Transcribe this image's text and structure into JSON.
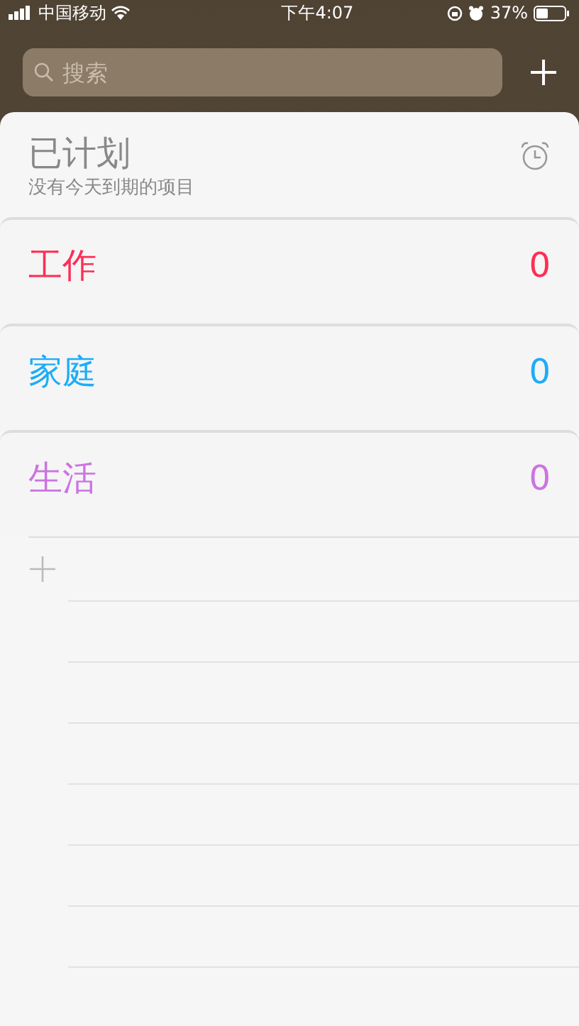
{
  "status_bar": {
    "carrier": "中国移动",
    "time": "下午4:07",
    "battery": "37%"
  },
  "search": {
    "placeholder": "搜索"
  },
  "scheduled": {
    "title": "已计划",
    "subtitle": "没有今天到期的项目"
  },
  "lists": [
    {
      "name": "工作",
      "count": "0",
      "color": "#ff2d55"
    },
    {
      "name": "家庭",
      "count": "0",
      "color": "#1badf8"
    },
    {
      "name": "生活",
      "count": "0",
      "color": "#cc73e1"
    }
  ]
}
